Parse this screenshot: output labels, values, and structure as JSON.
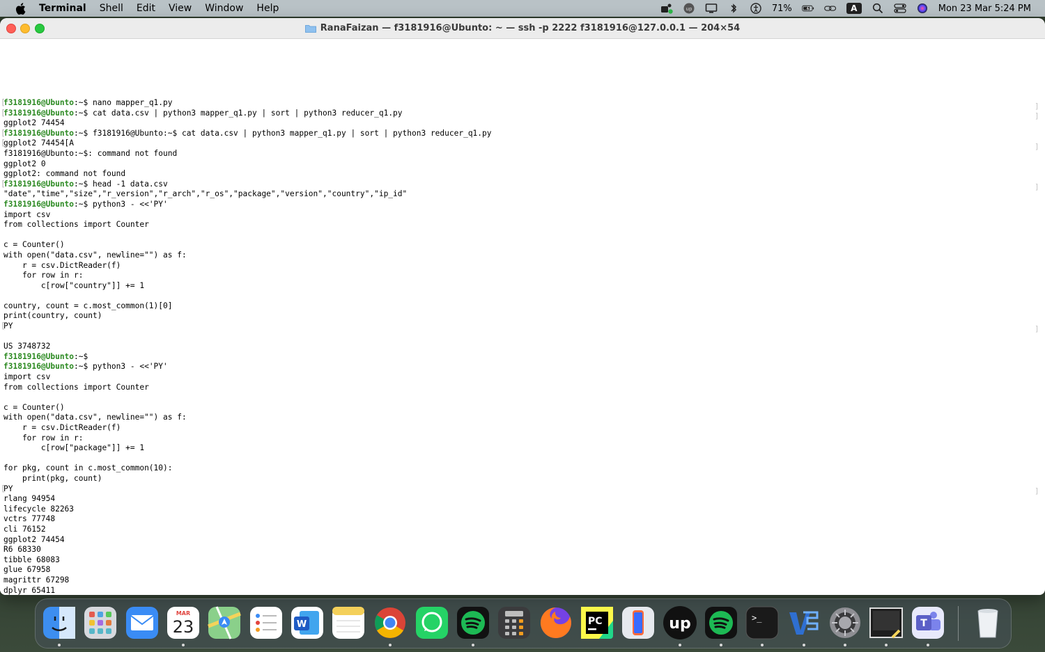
{
  "menubar": {
    "app_name": "Terminal",
    "items": [
      "Shell",
      "Edit",
      "View",
      "Window",
      "Help"
    ],
    "battery": "71%",
    "input_source": "A",
    "datetime": "Mon 23 Mar  5:24 PM"
  },
  "window": {
    "title": "RanaFaizan — f3181916@Ubunto: ~ — ssh -p 2222 f3181916@127.0.0.1 — 204×54"
  },
  "terminal": {
    "prompt": "f3181916@Ubunto",
    "lines": [
      {
        "p": true,
        "t": ":~$ nano mapper_q1.py"
      },
      {
        "p": true,
        "t": ":~$ cat data.csv | python3 mapper_q1.py | sort | python3 reducer_q1.py"
      },
      {
        "p": false,
        "t": "ggplot2 74454"
      },
      {
        "p": true,
        "t": ":~$ f3181916@Ubunto:~$ cat data.csv | python3 mapper_q1.py | sort | python3 reducer_q1.py"
      },
      {
        "p": false,
        "t": "ggplot2 74454[A"
      },
      {
        "p": false,
        "t": "f3181916@Ubunto:~$: command not found"
      },
      {
        "p": false,
        "t": "ggplot2 0"
      },
      {
        "p": false,
        "t": "ggplot2: command not found"
      },
      {
        "p": true,
        "t": ":~$ head -1 data.csv"
      },
      {
        "p": false,
        "t": "\"date\",\"time\",\"size\",\"r_version\",\"r_arch\",\"r_os\",\"package\",\"version\",\"country\",\"ip_id\""
      },
      {
        "p": true,
        "t": ":~$ python3 - <<'PY'"
      },
      {
        "p": false,
        "t": "import csv"
      },
      {
        "p": false,
        "t": "from collections import Counter"
      },
      {
        "p": false,
        "t": ""
      },
      {
        "p": false,
        "t": "c = Counter()"
      },
      {
        "p": false,
        "t": "with open(\"data.csv\", newline=\"\") as f:"
      },
      {
        "p": false,
        "t": "    r = csv.DictReader(f)"
      },
      {
        "p": false,
        "t": "    for row in r:"
      },
      {
        "p": false,
        "t": "        c[row[\"country\"]] += 1"
      },
      {
        "p": false,
        "t": ""
      },
      {
        "p": false,
        "t": "country, count = c.most_common(1)[0]"
      },
      {
        "p": false,
        "t": "print(country, count)"
      },
      {
        "p": false,
        "t": "PY"
      },
      {
        "p": false,
        "t": ""
      },
      {
        "p": false,
        "t": "US 3748732"
      },
      {
        "p": true,
        "t": ":~$"
      },
      {
        "p": true,
        "t": ":~$ python3 - <<'PY'"
      },
      {
        "p": false,
        "t": "import csv"
      },
      {
        "p": false,
        "t": "from collections import Counter"
      },
      {
        "p": false,
        "t": ""
      },
      {
        "p": false,
        "t": "c = Counter()"
      },
      {
        "p": false,
        "t": "with open(\"data.csv\", newline=\"\") as f:"
      },
      {
        "p": false,
        "t": "    r = csv.DictReader(f)"
      },
      {
        "p": false,
        "t": "    for row in r:"
      },
      {
        "p": false,
        "t": "        c[row[\"package\"]] += 1"
      },
      {
        "p": false,
        "t": ""
      },
      {
        "p": false,
        "t": "for pkg, count in c.most_common(10):"
      },
      {
        "p": false,
        "t": "    print(pkg, count)"
      },
      {
        "p": false,
        "t": "PY"
      },
      {
        "p": false,
        "t": "rlang 94954"
      },
      {
        "p": false,
        "t": "lifecycle 82263"
      },
      {
        "p": false,
        "t": "vctrs 77748"
      },
      {
        "p": false,
        "t": "cli 76152"
      },
      {
        "p": false,
        "t": "ggplot2 74454"
      },
      {
        "p": false,
        "t": "R6 68330"
      },
      {
        "p": false,
        "t": "tibble 68083"
      },
      {
        "p": false,
        "t": "glue 67958"
      },
      {
        "p": false,
        "t": "magrittr 67298"
      },
      {
        "p": false,
        "t": "dplyr 65411"
      },
      {
        "p": true,
        "t": ":~$ ",
        "cursor": true
      }
    ]
  },
  "dock": {
    "calendar_month": "MAR",
    "calendar_day": "23",
    "pycharm_label": "PC",
    "terminal_glyph": ">_",
    "apps": [
      {
        "name": "finder",
        "color": "#3d8ef0"
      },
      {
        "name": "launchpad",
        "color": "#d7d9de"
      },
      {
        "name": "mail",
        "color": "#3a8cf5"
      },
      {
        "name": "calendar",
        "color": "#ffffff"
      },
      {
        "name": "maps",
        "color": "#62b85a"
      },
      {
        "name": "reminders",
        "color": "#ffffff"
      },
      {
        "name": "word",
        "color": "#1f5bc4"
      },
      {
        "name": "notes",
        "color": "#f4d05a"
      },
      {
        "name": "chrome",
        "color": "#ffffff"
      },
      {
        "name": "whatsapp",
        "color": "#25d366"
      },
      {
        "name": "spotify",
        "color": "#1db954"
      },
      {
        "name": "calculator",
        "color": "#5b5b5b"
      },
      {
        "name": "firefox",
        "color": "#ff7a20"
      },
      {
        "name": "pycharm",
        "color": "#21d789"
      },
      {
        "name": "iphone-mirroring",
        "color": "#d0d4da"
      },
      {
        "name": "upwork",
        "color": "#111111"
      },
      {
        "name": "spotify",
        "color": "#1db954"
      },
      {
        "name": "terminal",
        "color": "#1a1a1a"
      },
      {
        "name": "vm-fusion",
        "color": "#2f6fd1"
      },
      {
        "name": "system-settings",
        "color": "#8e8e93"
      },
      {
        "name": "screenshot-preview",
        "color": "#2a2a2a"
      },
      {
        "name": "teams",
        "color": "#5b5fc7"
      },
      {
        "name": "trash",
        "color": "#e6e9ec"
      }
    ]
  }
}
